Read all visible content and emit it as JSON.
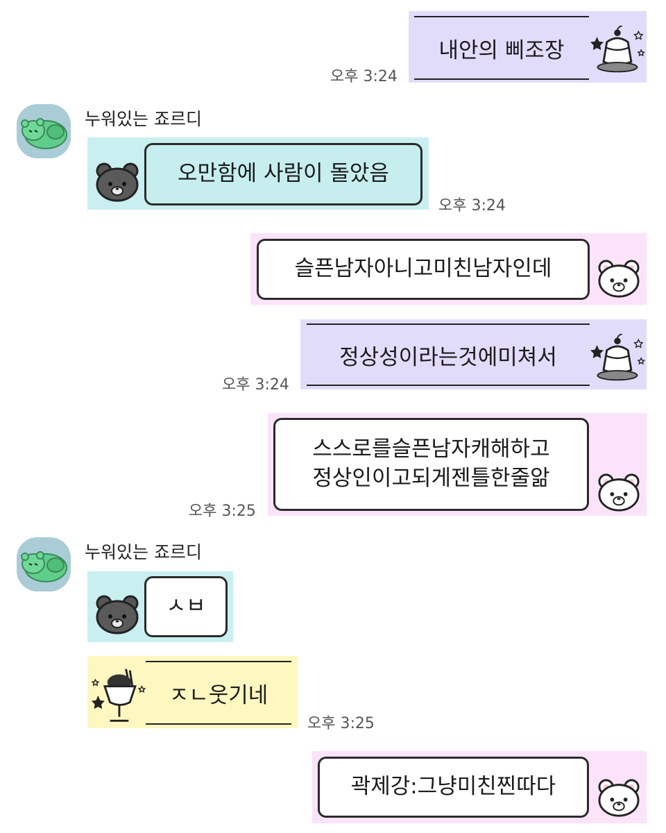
{
  "messages": {
    "m1": {
      "text": "내안의 삐조장",
      "time": "오후 3:24"
    },
    "sender": {
      "name": "누워있는 죠르디"
    },
    "m2": {
      "text": "오만함에 사람이 돌았음",
      "time": "오후 3:24"
    },
    "m3": {
      "text": "슬픈남자아니고미친남자인데"
    },
    "m4": {
      "text": "정상성이라는것에미쳐서",
      "time": "오후 3:24"
    },
    "m5": {
      "line1": "스스로를슬픈남자캐해하고",
      "line2": "정상인이고되게젠틀한줄앎",
      "time": "오후 3:25"
    },
    "sender2": {
      "name": "누워있는 죠르디"
    },
    "m6": {
      "text": "ㅅㅂ"
    },
    "m7": {
      "text": "ㅈㄴ웃기네",
      "time": "오후 3:25"
    },
    "m8": {
      "text": "곽제강:그냥미친찐따다"
    }
  },
  "colors": {
    "lavender": "#e2dcfb",
    "pink": "#fbe3fa",
    "teal": "#c9eff0",
    "yellow": "#fef7c0",
    "avatar_bg": "#a9ccd6"
  },
  "icons": [
    "pudding-icon",
    "bear-icon",
    "dark-bear-icon",
    "parfait-icon",
    "jordy-avatar-icon"
  ]
}
